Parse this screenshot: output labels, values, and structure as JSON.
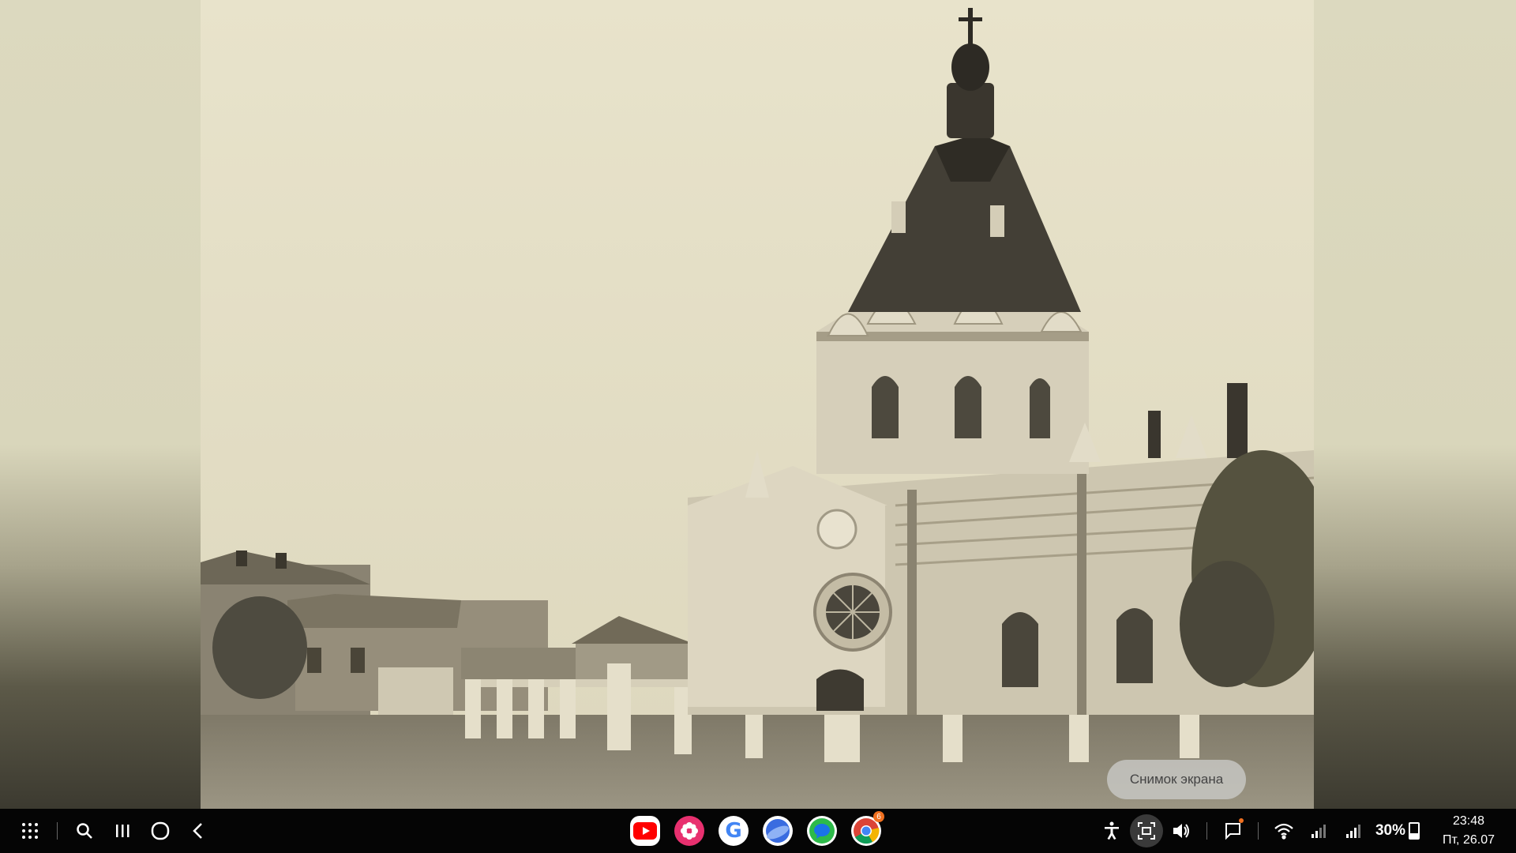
{
  "toast": {
    "text": "Снимок экрана"
  },
  "taskbar": {
    "nav_buttons": [
      "apps-grid",
      "search",
      "recents",
      "home",
      "back"
    ],
    "pinned_apps": [
      {
        "name": "YouTube",
        "icon": "youtube-icon",
        "color": "#ff0000"
      },
      {
        "name": "Blossom",
        "icon": "flower-icon",
        "color": "#e8306f"
      },
      {
        "name": "Google",
        "icon": "google-icon",
        "color": "#ffffff"
      },
      {
        "name": "Internet",
        "icon": "internet-icon",
        "color": "#3a6ce0"
      },
      {
        "name": "Messages",
        "icon": "messages-icon",
        "color": "#2dba4a"
      },
      {
        "name": "Chrome",
        "icon": "chrome-icon",
        "color": "#ffffff",
        "badge": "6"
      }
    ],
    "battery": "30%",
    "time": "23:48",
    "date": "Пт, 26.07"
  }
}
